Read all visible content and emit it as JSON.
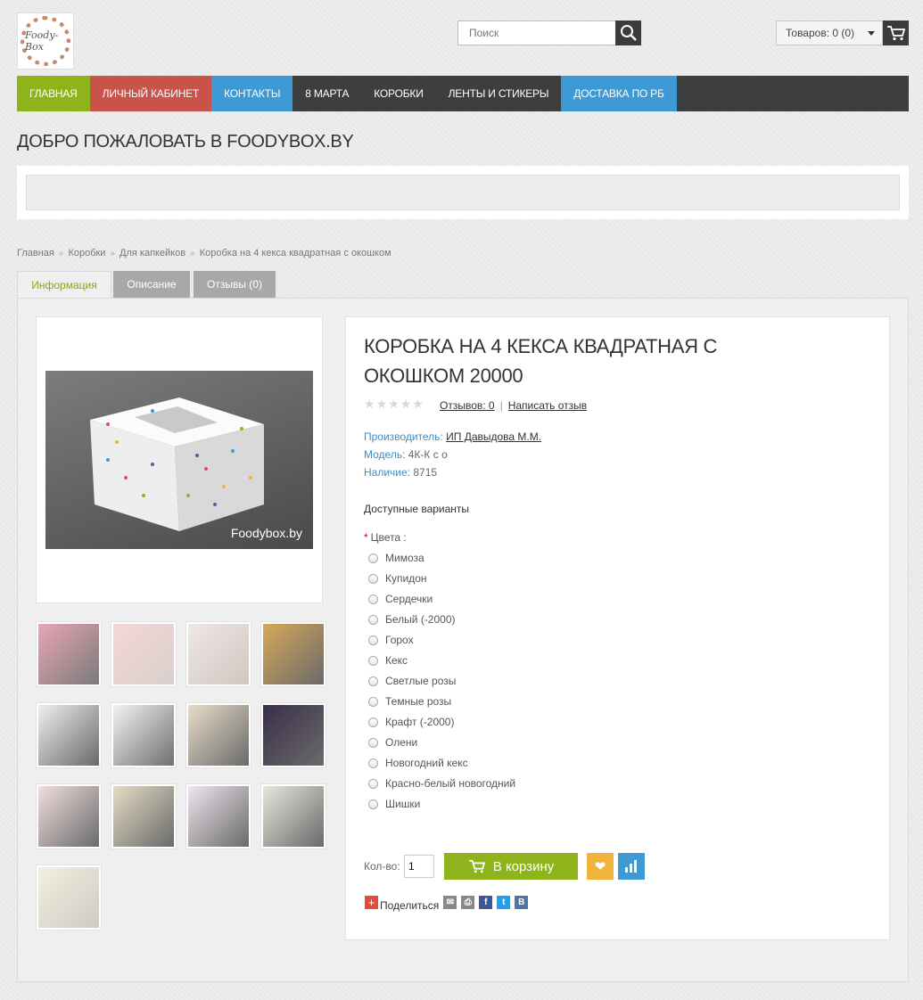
{
  "header": {
    "logo_text": "Foody-Box",
    "search_placeholder": "Поиск",
    "cart_label": "Товаров: 0 (0)"
  },
  "nav": [
    {
      "label": "ГЛАВНАЯ",
      "color": "#8fb31a"
    },
    {
      "label": "ЛИЧНЫЙ КАБИНЕТ",
      "color": "#c9524b"
    },
    {
      "label": "КОНТАКТЫ",
      "color": "#3d9ad4"
    },
    {
      "label": "8 МАРТА",
      "color": ""
    },
    {
      "label": "КОРОБКИ",
      "color": ""
    },
    {
      "label": "ЛЕНТЫ И СТИКЕРЫ",
      "color": ""
    },
    {
      "label": "ДОСТАВКА ПО РБ",
      "color": "#3d9ad4"
    }
  ],
  "welcome": "ДОБРО ПОЖАЛОВАТЬ В FOODYBOX.BY",
  "breadcrumb": [
    "Главная",
    "Коробки",
    "Для капкейков",
    "Коробка на 4 кекса квадратная с окошком"
  ],
  "tabs": [
    "Информация",
    "Описание",
    "Отзывы (0)"
  ],
  "product": {
    "title": "КОРОБКА НА 4 КЕКСА КВАДРАТНАЯ С ОКОШКОМ 20000",
    "image_watermark": "Foodybox.by",
    "reviews_link": "Отзывов: 0",
    "write_review": "Написать отзыв",
    "manufacturer_label": "Производитель:",
    "manufacturer": "ИП Давыдова М.М.",
    "model_label": "Модель:",
    "model": "4К-К с о",
    "stock_label": "Наличие:",
    "stock": "8715",
    "options_title": "Доступные варианты",
    "colors_label": "Цвета :",
    "colors": [
      "Мимоза",
      "Купидон",
      "Сердечки",
      "Белый (-2000)",
      "Горох",
      "Кекс",
      "Светлые розы",
      "Темные розы",
      "Крафт (-2000)",
      "Олени",
      "Новогодний кекс",
      "Красно-белый новогодний",
      "Шишки"
    ],
    "qty_label": "Кол-во:",
    "qty_value": "1",
    "add_to_cart": "В корзину",
    "share_label": "Поделиться"
  },
  "accent_colors": {
    "green": "#8fb31a",
    "red": "#c9524b",
    "blue": "#3d9ad4",
    "orange": "#f0b43c"
  }
}
